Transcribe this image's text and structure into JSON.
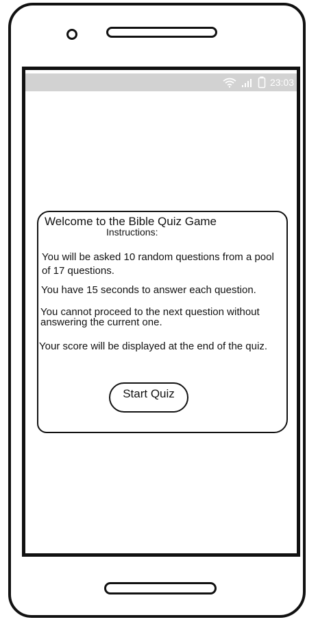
{
  "status_bar": {
    "time": "23:03",
    "icons": [
      "wifi-icon",
      "signal-icon",
      "battery-icon"
    ]
  },
  "quiz": {
    "title": "Welcome to the Bible Quiz Game",
    "instructions_label": "Instructions:",
    "instructions": [
      "You will be asked 10 random questions from a pool of 17 questions.",
      "You have 15 seconds to answer each question.",
      "You cannot proceed to the next question without answering the current one.",
      "Your score will be displayed at the end of the quiz."
    ],
    "start_button": "Start Quiz"
  },
  "colors": {
    "status_bar_bg": "#d2d2d2",
    "outline": "#111111"
  }
}
